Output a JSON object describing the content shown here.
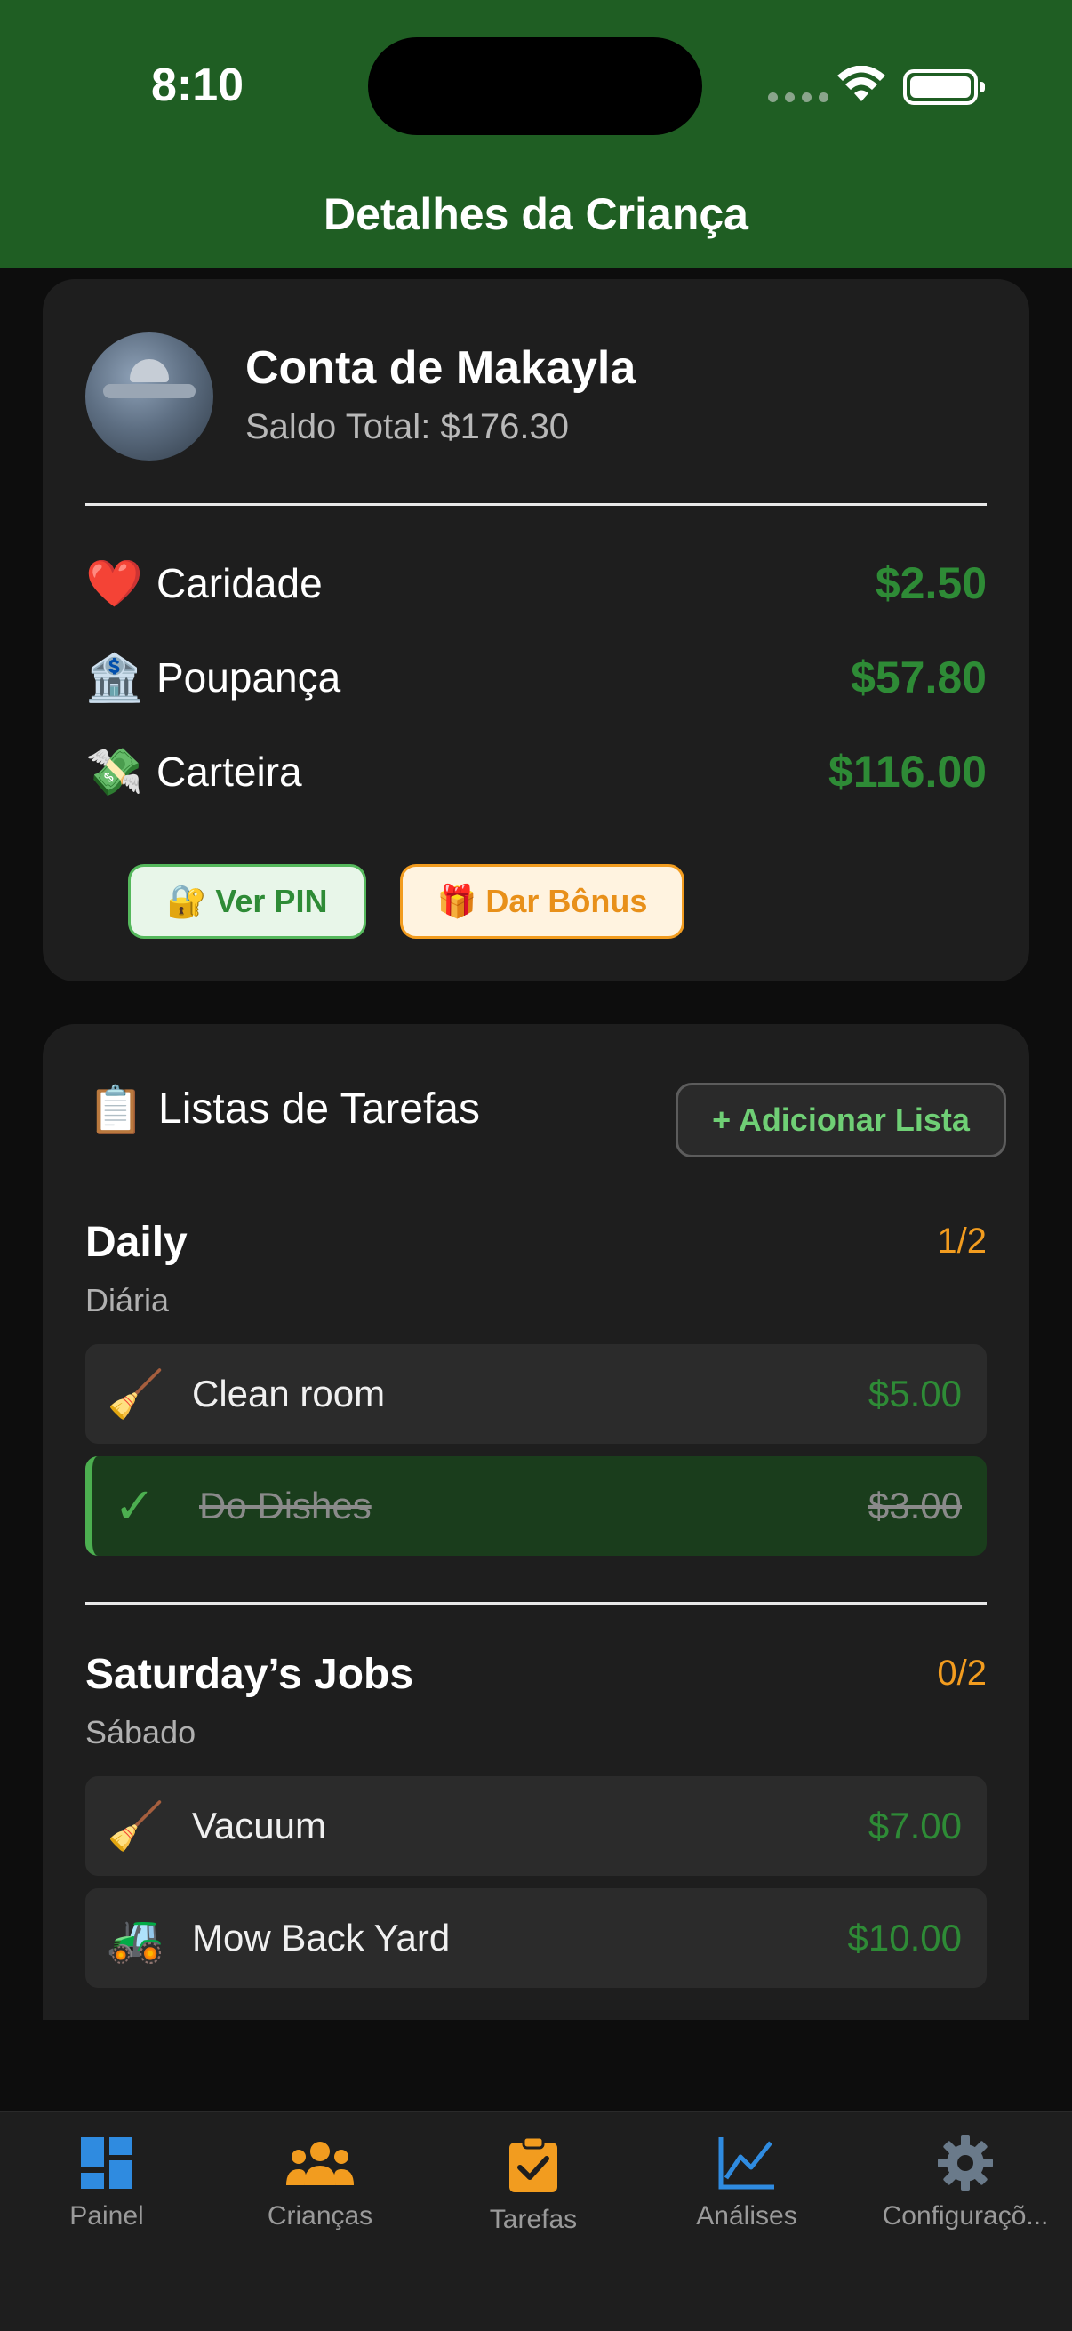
{
  "status_bar": {
    "time": "8:10"
  },
  "header": {
    "title": "Detalhes da Criança"
  },
  "account": {
    "name": "Conta de Makayla",
    "balance": "Saldo Total: $176.30"
  },
  "buckets": [
    {
      "icon": "❤️",
      "icon_name": "heart-icon",
      "label": "Caridade",
      "amount": "$2.50"
    },
    {
      "icon": "🏦",
      "icon_name": "bank-icon",
      "label": "Poupança",
      "amount": "$57.80"
    },
    {
      "icon": "💸",
      "icon_name": "money-wings-icon",
      "label": "Carteira",
      "amount": "$116.00"
    }
  ],
  "actions": {
    "pin_icon": "🔐",
    "pin_label": "Ver PIN",
    "bonus_icon": "🎁",
    "bonus_label": "Dar Bônus"
  },
  "lists_section": {
    "icon": "📋",
    "title": "Listas de Tarefas",
    "add_label": "+ Adicionar Lista"
  },
  "lists": [
    {
      "name": "Daily",
      "count": "1/2",
      "frequency": "Diária",
      "chores": [
        {
          "icon": "🧹",
          "name": "Clean room",
          "amount": "$5.00",
          "done": false
        },
        {
          "icon": "✓",
          "name": "Do Dishes",
          "amount": "$3.00",
          "done": true
        }
      ]
    },
    {
      "name": "Saturday’s Jobs",
      "count": "0/2",
      "frequency": "Sábado",
      "chores": [
        {
          "icon": "🧹",
          "name": "Vacuum",
          "amount": "$7.00",
          "done": false
        },
        {
          "icon": "🚜",
          "name": "Mow Back Yard",
          "amount": "$10.00",
          "done": false
        }
      ]
    }
  ],
  "tabbar": {
    "tabs": [
      {
        "label": "Painel",
        "icon_name": "dashboard-icon",
        "color": "#2f8be0"
      },
      {
        "label": "Crianças",
        "icon_name": "people-icon",
        "color": "#f29c1f"
      },
      {
        "label": "Tarefas",
        "icon_name": "clipboard-check-icon",
        "color": "#f29c1f"
      },
      {
        "label": "Análises",
        "icon_name": "chart-line-icon",
        "color": "#2f8be0"
      },
      {
        "label": "Configuraçõ...",
        "icon_name": "gear-icon",
        "color": "#6a7a8a"
      }
    ]
  },
  "colors": {
    "header_green": "#1f5e23",
    "money_green": "#2e8b36",
    "accent_orange": "#f29c1f",
    "accent_blue": "#2f8be0"
  }
}
